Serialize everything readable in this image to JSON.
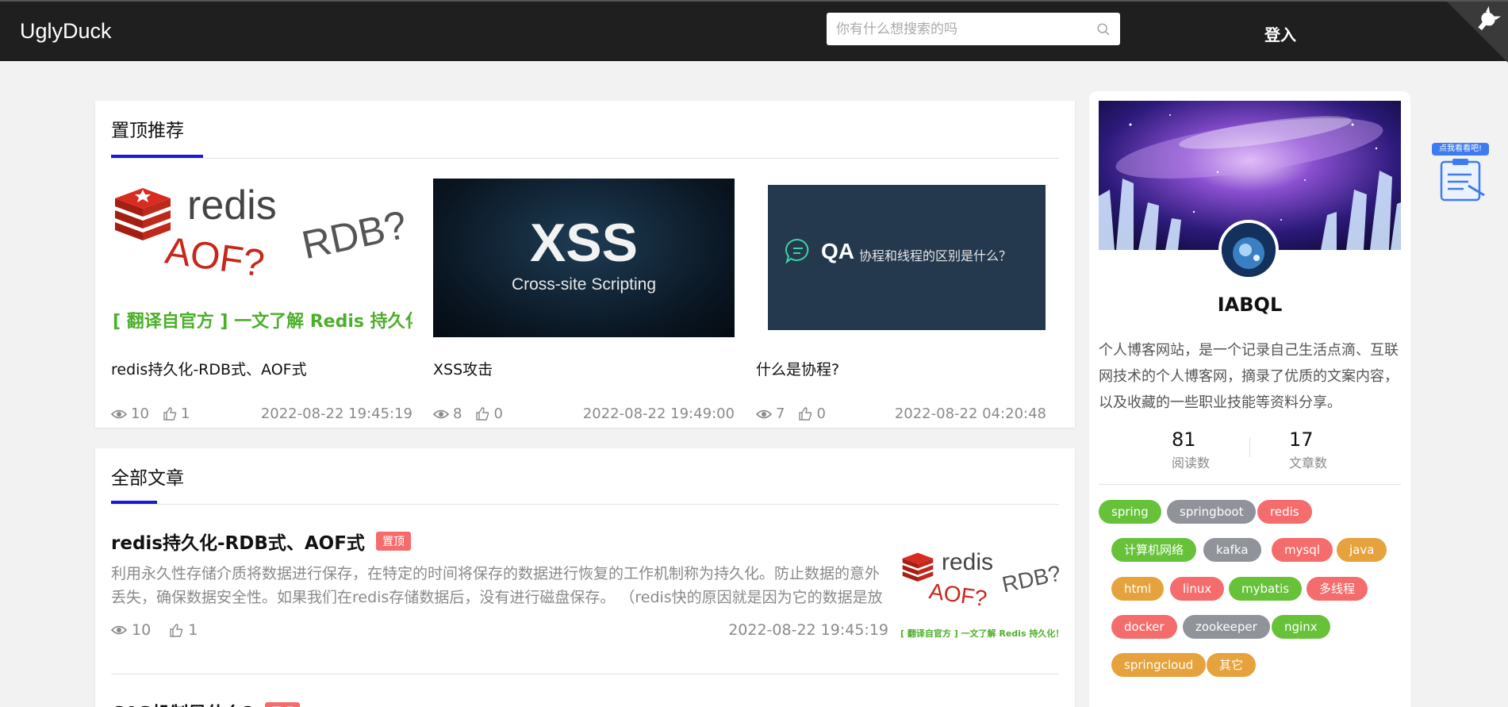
{
  "header": {
    "logo": "UglyDuck",
    "search_placeholder": "你有什么想搜索的吗",
    "login": "登入"
  },
  "pinned": {
    "title": "置顶推荐",
    "items": [
      {
        "title": "redis持久化-RDB式、AOF式",
        "views": "10",
        "likes": "1",
        "date": "2022-08-22 19:45:19",
        "img": {
          "word": "redis",
          "q1": "AOF?",
          "q2": "RDB?",
          "caption": "[ 翻译自官方 ] 一文了解 Redis 持久化！"
        }
      },
      {
        "title": "XSS攻击",
        "views": "8",
        "likes": "0",
        "date": "2022-08-22 19:49:00",
        "img": {
          "big": "XSS",
          "sub": "Cross-site Scripting"
        }
      },
      {
        "title": "什么是协程?",
        "views": "7",
        "likes": "0",
        "date": "2022-08-22 04:20:48",
        "img": {
          "qa": "QA",
          "question": "协程和线程的区别是什么？"
        }
      }
    ]
  },
  "articles": {
    "title": "全部文章",
    "badge": "置顶",
    "list": [
      {
        "title": "redis持久化-RDB式、AOF式",
        "summary": "利用永久性存储介质将数据进行保存，在特定的时间将保存的数据进行恢复的工作机制称为持久化。防止数据的意外丢失，确保数据安全性。如果我们在redis存储数据后，没有进行磁盘保存。 （redis快的原因就是因为它的数据是放置在",
        "views": "10",
        "likes": "1",
        "date": "2022-08-22 19:45:19",
        "thumb": {
          "word": "redis",
          "q1": "AOF?",
          "q2": "RDB?",
          "caption": "[ 翻译自官方 ] 一文了解 Redis 持久化！"
        }
      },
      {
        "title": "CAS机制是什么?"
      }
    ]
  },
  "profile": {
    "name": "IABQL",
    "bio": "个人博客网站，是一个记录自己生活点滴、互联网技术的个人博客网，摘录了优质的文案内容，以及收藏的一些职业技能等资料分享。",
    "reads": "81",
    "reads_label": "阅读数",
    "posts": "17",
    "posts_label": "文章数"
  },
  "tags": [
    {
      "name": "spring",
      "color": "#67c23a"
    },
    {
      "name": "springboot",
      "color": "#909399"
    },
    {
      "name": "redis",
      "color": "#f56c6c"
    },
    {
      "name": "计算机网络",
      "color": "#67c23a"
    },
    {
      "name": "kafka",
      "color": "#909399"
    },
    {
      "name": "mysql",
      "color": "#f56c6c"
    },
    {
      "name": "java",
      "color": "#e6a23c"
    },
    {
      "name": "html",
      "color": "#e6a23c"
    },
    {
      "name": "linux",
      "color": "#f56c6c"
    },
    {
      "name": "mybatis",
      "color": "#67c23a"
    },
    {
      "name": "多线程",
      "color": "#f56c6c"
    },
    {
      "name": "docker",
      "color": "#f56c6c"
    },
    {
      "name": "zookeeper",
      "color": "#909399"
    },
    {
      "name": "nginx",
      "color": "#67c23a"
    },
    {
      "name": "springcloud",
      "color": "#e6a23c"
    },
    {
      "name": "其它",
      "color": "#e6a23c"
    }
  ],
  "widget": {
    "label": "点我看看吧!"
  },
  "colors": {
    "accent": "#1a1adb",
    "header_bg": "#1f1f1f",
    "badge": "#f56c6c"
  },
  "icons": {
    "views": "eye-icon",
    "likes": "thumbs-up-icon",
    "search": "search-icon",
    "corner": "github-corner-icon"
  }
}
